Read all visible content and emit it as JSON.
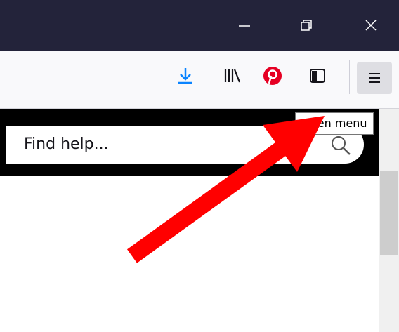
{
  "window": {
    "minimize_icon": "minimize-icon",
    "restore_icon": "restore-icon",
    "close_icon": "close-icon"
  },
  "toolbar": {
    "icons": [
      "download-icon",
      "library-icon",
      "pinterest-icon",
      "sidebar-icon",
      "hamburger-menu-icon"
    ]
  },
  "tooltip": {
    "text": "Open menu"
  },
  "search": {
    "placeholder": "Find help..."
  },
  "colors": {
    "titlebar": "#23233a",
    "download_blue": "#0a84ff",
    "pinterest_red": "#e60023",
    "arrow_red": "#ff0000"
  }
}
